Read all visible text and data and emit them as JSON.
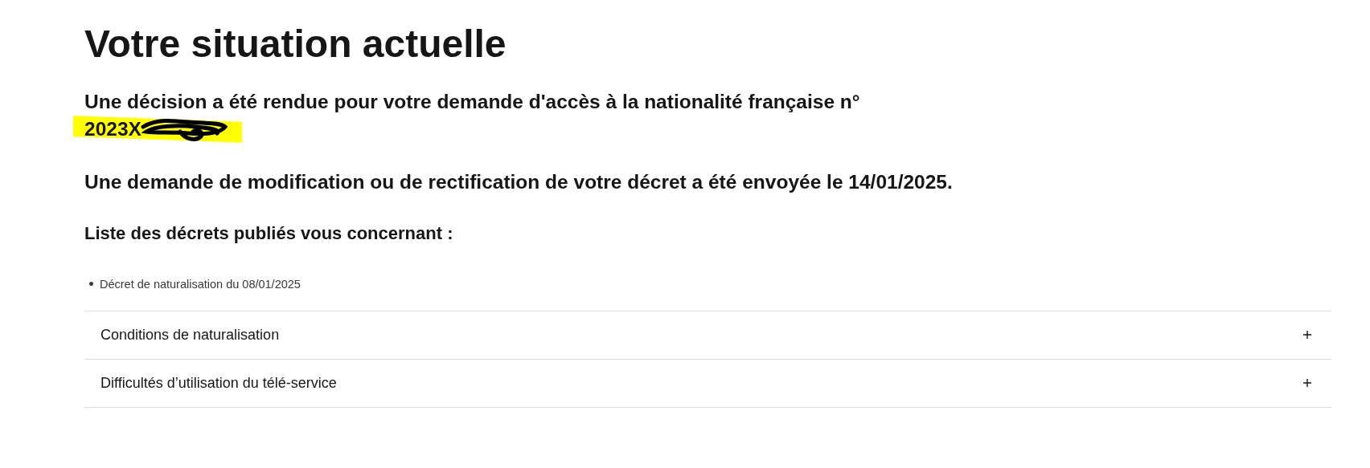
{
  "title": "Votre situation actuelle",
  "decision": {
    "text": "Une décision a été rendue pour votre demande d'accès à la nationalité française n°",
    "number": "2023X",
    "highlighted": true,
    "redacted": true
  },
  "request_notice": "Une demande de modification ou de rectification de votre décret a été envoyée le 14/01/2025.",
  "decrees": {
    "heading": "Liste des décrets publiés vous concernant :",
    "items": [
      "Décret de naturalisation du 08/01/2025"
    ]
  },
  "accordion": [
    {
      "label": "Conditions de naturalisation",
      "expanded": false
    },
    {
      "label": "Difficultés d’utilisation du télé-service",
      "expanded": false
    }
  ]
}
